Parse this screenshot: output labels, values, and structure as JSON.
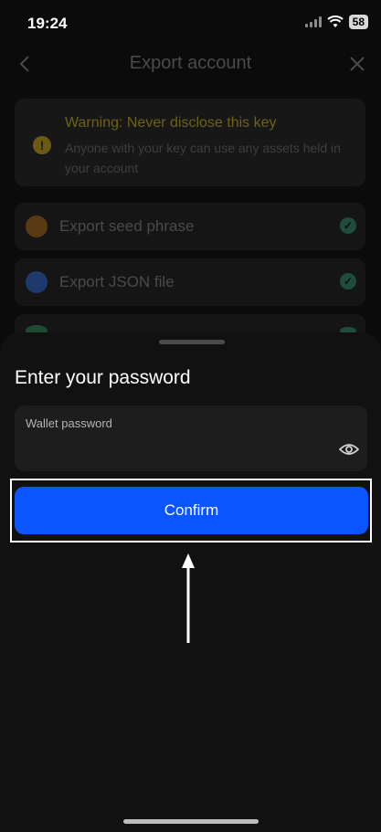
{
  "status_bar": {
    "time": "19:24",
    "battery": "58"
  },
  "header": {
    "title": "Export account"
  },
  "warning": {
    "title": "Warning: Never disclose this key",
    "description": "Anyone with your key can use any assets held in your account"
  },
  "options": [
    {
      "label": "Export seed phrase",
      "icon": "seed-icon"
    },
    {
      "label": "Export JSON file",
      "icon": "json-file-icon"
    }
  ],
  "sheet": {
    "title": "Enter your password",
    "password_label": "Wallet password",
    "password_value": "",
    "confirm_label": "Confirm"
  },
  "colors": {
    "accent": "#0a55ff",
    "warning": "#6d6217",
    "check": "#1f4c3c"
  }
}
